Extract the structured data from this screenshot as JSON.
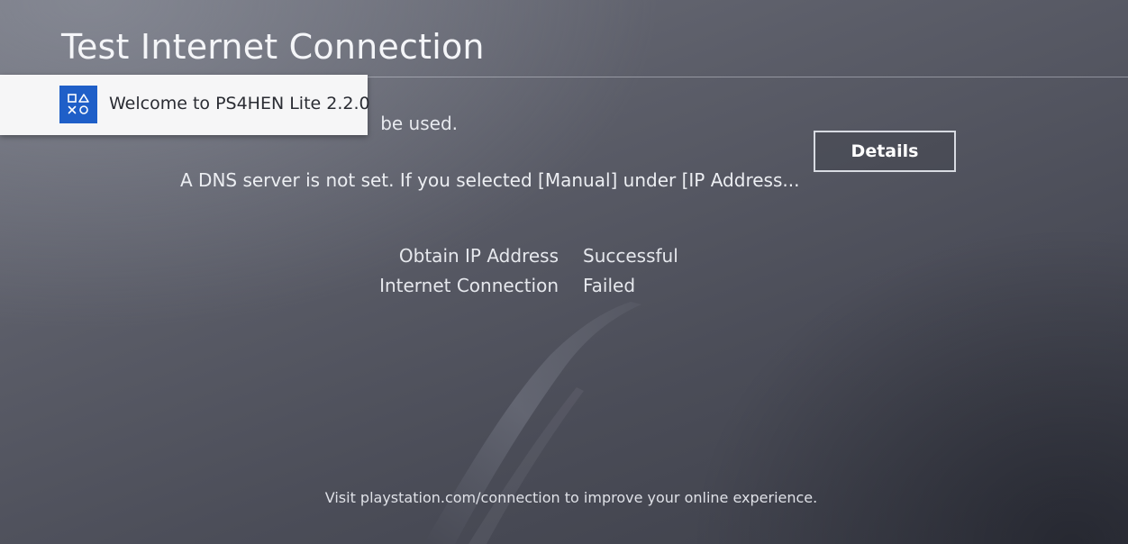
{
  "header": {
    "title": "Test Internet Connection"
  },
  "notification": {
    "icon": "playstation-buttons-icon",
    "message": "Welcome to PS4HEN Lite 2.2.0"
  },
  "main": {
    "partial_line": "be used.",
    "dns_message": "A DNS server is not set. If you selected [Manual] under [IP Address...",
    "details_button": "Details",
    "results": [
      {
        "label": "Obtain IP Address",
        "value": "Successful"
      },
      {
        "label": "Internet Connection",
        "value": "Failed"
      }
    ]
  },
  "footer": {
    "text": "Visit playstation.com/connection to improve your online experience."
  },
  "colors": {
    "notification_icon_bg": "#1f5fc8",
    "notification_bg": "#f6f6f7"
  }
}
